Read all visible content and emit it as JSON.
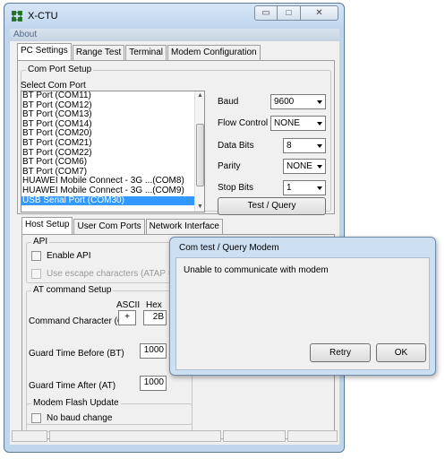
{
  "window": {
    "title": "X-CTU",
    "controls": {
      "minimize": "▭",
      "maximize": "□",
      "close": "✕"
    }
  },
  "menu": {
    "about": "About"
  },
  "tabs": [
    "PC Settings",
    "Range Test",
    "Terminal",
    "Modem Configuration"
  ],
  "com_port_setup": {
    "title": "Com Port Setup",
    "select_label": "Select Com Port",
    "ports": [
      "BT Port (COM11)",
      "BT Port (COM12)",
      "BT Port (COM13)",
      "BT Port (COM14)",
      "BT Port (COM20)",
      "BT Port (COM21)",
      "BT Port (COM22)",
      "BT Port (COM6)",
      "BT Port (COM7)",
      "HUAWEI Mobile Connect - 3G ...(COM8)",
      "HUAWEI Mobile Connect - 3G ...(COM9)",
      "USB Serial Port (COM30)"
    ],
    "selected_port": "USB Serial Port (COM30)",
    "settings": {
      "baud": {
        "label": "Baud",
        "value": "9600"
      },
      "flow_control": {
        "label": "Flow Control",
        "value": "NONE"
      },
      "data_bits": {
        "label": "Data Bits",
        "value": "8"
      },
      "parity": {
        "label": "Parity",
        "value": "NONE"
      },
      "stop_bits": {
        "label": "Stop Bits",
        "value": "1"
      }
    },
    "test_button": "Test / Query"
  },
  "lower_tabs": [
    "Host Setup",
    "User Com Ports",
    "Network Interface"
  ],
  "api": {
    "title": "API",
    "enable_api": "Enable API",
    "escape_chars": "Use escape characters (ATAP = 2)"
  },
  "at_command": {
    "title": "AT command Setup",
    "ascii_header": "ASCII",
    "hex_header": "Hex",
    "command_character_label": "Command Character (CC)",
    "cc_ascii": "+",
    "cc_hex": "2B",
    "guard_before_label": "Guard Time Before (BT)",
    "guard_before": "1000",
    "guard_after_label": "Guard Time After (AT)",
    "guard_after": "1000"
  },
  "modem_flash": {
    "title": "Modem Flash Update",
    "no_baud_change": "No baud change"
  },
  "dialog": {
    "title": "Com test / Query Modem",
    "message": "Unable to communicate with modem",
    "retry": "Retry",
    "ok": "OK"
  },
  "colors": {
    "selection": "#3399ff",
    "window_frame": "#bfd6ec",
    "dialog_frame": "#cde0f1"
  },
  "icons": {
    "app": "xbee-app-icon",
    "list_up": "▲",
    "list_down": "▼"
  }
}
